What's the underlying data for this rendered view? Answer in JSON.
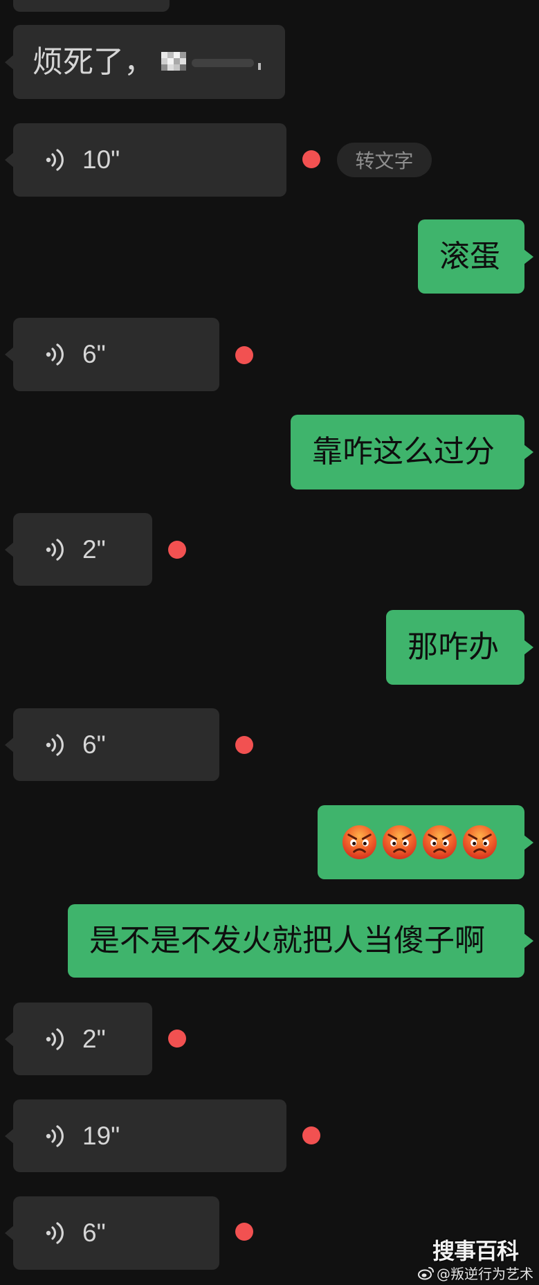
{
  "colors": {
    "background": "#111111",
    "received_bubble": "#2c2c2c",
    "sent_bubble": "#3fb46c",
    "unread_dot": "#f25151"
  },
  "conversation": {
    "messages": [
      {
        "kind": "text",
        "sender": "other",
        "text": "烦死了，",
        "partially_censored": true
      },
      {
        "kind": "voice",
        "sender": "other",
        "duration": "10\"",
        "unread": true,
        "transcribe_label": "转文字"
      },
      {
        "kind": "text",
        "sender": "me",
        "text": "滚蛋"
      },
      {
        "kind": "voice",
        "sender": "other",
        "duration": "6\"",
        "unread": true
      },
      {
        "kind": "text",
        "sender": "me",
        "text": "靠咋这么过分"
      },
      {
        "kind": "voice",
        "sender": "other",
        "duration": "2\"",
        "unread": true
      },
      {
        "kind": "text",
        "sender": "me",
        "text": "那咋办"
      },
      {
        "kind": "voice",
        "sender": "other",
        "duration": "6\"",
        "unread": true
      },
      {
        "kind": "emoji",
        "sender": "me",
        "emojis": [
          "angry-face",
          "angry-face",
          "angry-face",
          "angry-face"
        ]
      },
      {
        "kind": "text",
        "sender": "me",
        "text": "是不是不发火就把人当傻子啊"
      },
      {
        "kind": "voice",
        "sender": "other",
        "duration": "2\"",
        "unread": true
      },
      {
        "kind": "voice",
        "sender": "other",
        "duration": "19\"",
        "unread": true
      },
      {
        "kind": "voice",
        "sender": "other",
        "duration": "6\"",
        "unread": true
      }
    ]
  },
  "watermark": {
    "logo_text": "搜事百科",
    "handle": "@叛逆行为艺术",
    "handle_icon": "weibo-icon"
  }
}
